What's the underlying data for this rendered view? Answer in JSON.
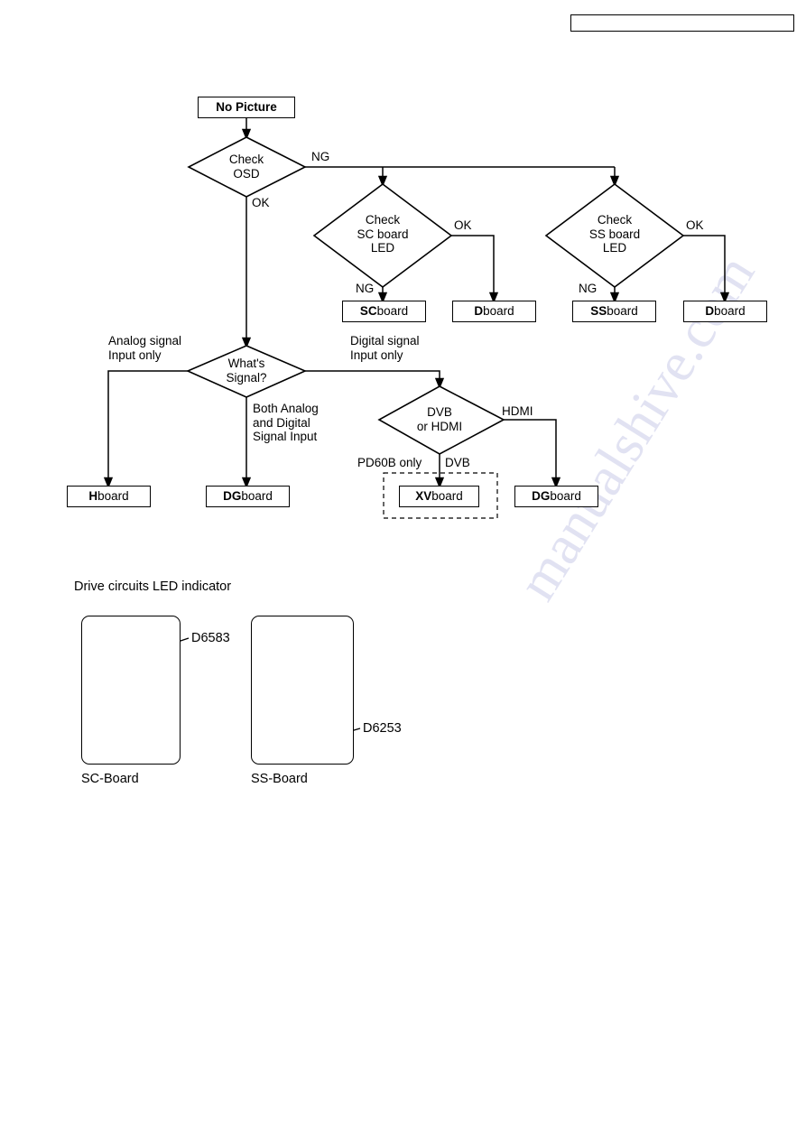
{
  "document": {
    "header_box_text": "",
    "flowchart_title": "No Picture"
  },
  "flowchart": {
    "nodes": {
      "start": {
        "label": "No Picture",
        "type": "terminal"
      },
      "check_osd": {
        "line1": "Check",
        "line2": "OSD",
        "type": "decision"
      },
      "check_sc_led": {
        "line1": "Check",
        "line2": "SC board",
        "line3": "LED",
        "type": "decision"
      },
      "check_ss_led": {
        "line1": "Check",
        "line2": "SS board",
        "line3": "LED",
        "type": "decision"
      },
      "whats_signal": {
        "line1": "What's",
        "line2": "Signal?",
        "type": "decision"
      },
      "dvb_or_hdmi": {
        "line1": "DVB",
        "line2": "or HDMI",
        "type": "decision"
      }
    },
    "results": {
      "sc_board": {
        "bold": "SC",
        "rest": " board"
      },
      "d_board_1": {
        "bold": "D",
        "rest": " board"
      },
      "ss_board": {
        "bold": "SS",
        "rest": " board"
      },
      "d_board_2": {
        "bold": "D",
        "rest": " board"
      },
      "h_board": {
        "bold": "H",
        "rest": " board"
      },
      "dg_board_1": {
        "bold": "DG",
        "rest": " board"
      },
      "xv_board": {
        "bold": "XV",
        "rest": " board"
      },
      "dg_board_2": {
        "bold": "DG",
        "rest": " board"
      }
    },
    "edge_labels": {
      "osd_ng": "NG",
      "osd_ok": "OK",
      "sc_ok": "OK",
      "sc_ng": "NG",
      "ss_ok": "OK",
      "ss_ng": "NG",
      "analog_only_l1": "Analog signal",
      "analog_only_l2": "Input only",
      "digital_only_l1": "Digital signal",
      "digital_only_l2": "Input only",
      "both_l1": "Both Analog",
      "both_l2": "and Digital",
      "both_l3": "Signal Input",
      "hdmi": "HDMI",
      "dvb": "DVB",
      "pd60b_only": "PD60B only"
    }
  },
  "led_section": {
    "title": "Drive circuits LED indicator",
    "boards": [
      {
        "caption": "SC-Board",
        "led_ref": "D6583",
        "led_icon": "led-shine-icon"
      },
      {
        "caption": "SS-Board",
        "led_ref": "D6253",
        "led_icon": "led-shine-icon"
      }
    ]
  },
  "colors": {
    "line": "#000000",
    "background": "#ffffff",
    "watermark": "#c9cbe8"
  },
  "watermark": {
    "text": "manualshive.com"
  }
}
